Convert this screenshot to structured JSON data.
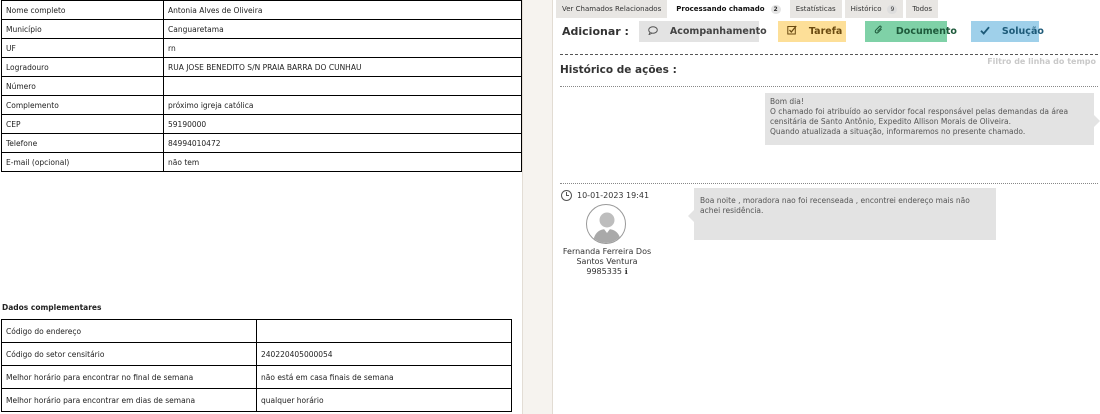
{
  "form": {
    "rows": [
      {
        "label": "Nome completo",
        "value": "Antonia Alves de Oliveira"
      },
      {
        "label": "Município",
        "value": "Canguaretama"
      },
      {
        "label": "UF",
        "value": "rn"
      },
      {
        "label": "Logradouro",
        "value": "RUA JOSE BENEDITO S/N PRAIA  BARRA DO CUNHAU"
      },
      {
        "label": "Número",
        "value": ""
      },
      {
        "label": "Complemento",
        "value": "próximo igreja católica"
      },
      {
        "label": "CEP",
        "value": "59190000"
      },
      {
        "label": "Telefone",
        "value": "84994010472"
      },
      {
        "label": "E-mail (opcional)",
        "value": "não tem"
      }
    ]
  },
  "complementares": {
    "title": "Dados complementares",
    "rows": [
      {
        "label": "Código do endereço",
        "value": ""
      },
      {
        "label": "Código do setor censitário",
        "value": "240220405000054"
      },
      {
        "label": "Melhor horário para encontrar no final de semana",
        "value": "não está em casa finais de semana"
      },
      {
        "label": "Melhor horário para encontrar em dias de semana",
        "value": "qualquer horário"
      }
    ]
  },
  "tabs": [
    {
      "label": "Ver Chamados Relacionados",
      "badge": ""
    },
    {
      "label": "Processando chamado",
      "badge": "2"
    },
    {
      "label": "Estatísticas",
      "badge": ""
    },
    {
      "label": "Histórico",
      "badge": "9"
    },
    {
      "label": "Todos",
      "badge": ""
    }
  ],
  "actions": {
    "label": "Adicionar :",
    "acompanhamento": "Acompanhamento",
    "tarefa": "Tarefa",
    "documento": "Documento",
    "solucao": "Solução"
  },
  "history": {
    "filter_placeholder": "Filtro de linha do tempo",
    "title": "Histórico de ações :",
    "entry1_lines": [
      "Bom dia!",
      "O chamado foi atribuído ao servidor focal responsável pelas demandas da área censitária de Santo Antônio, Expedito Allison Morais de Oliveira.",
      "Quando atualizada a situação, informaremos no presente chamado."
    ],
    "entry2": {
      "date": "10-01-2023 19:41",
      "author_line1": "Fernanda Ferreira Dos",
      "author_line2": "Santos Ventura",
      "author_id": "9985335",
      "text": "Boa noite , moradora nao foi recenseada , encontrei endereço mais não achei residência."
    }
  },
  "colors": {
    "tarefa": "#fddf98",
    "documento": "#7fd1a7",
    "solucao": "#9fd0ea",
    "bubble": "#e3e3e3"
  }
}
